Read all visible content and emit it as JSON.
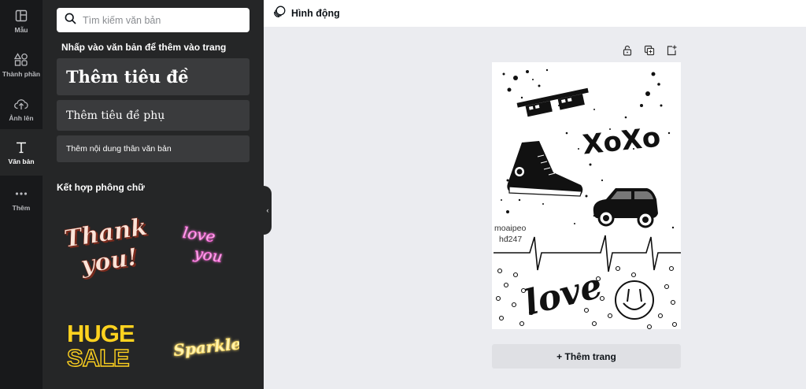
{
  "rail": {
    "items": [
      {
        "label": "Mẫu",
        "icon": "template-icon"
      },
      {
        "label": "Thành phần",
        "icon": "shapes-icon"
      },
      {
        "label": "Ảnh lên",
        "icon": "upload-icon"
      },
      {
        "label": "Văn bản",
        "icon": "text-icon"
      },
      {
        "label": "Thêm",
        "icon": "more-icon"
      }
    ]
  },
  "panel": {
    "search_placeholder": "Tìm kiếm văn bản",
    "heading": "Nhấp vào văn bản để thêm vào trang",
    "add_heading": "Thêm tiêu đề",
    "add_subheading": "Thêm tiêu đề phụ",
    "add_body": "Thêm nội dung thân văn bản",
    "combo_heading": "Kết hợp phông chữ",
    "combos": {
      "thank_line1": "Thank",
      "thank_line2": "you!",
      "love_line1": "love",
      "love_line2": "you",
      "huge_line1": "HUGE",
      "huge_line2": "SALE",
      "sparkle": "Sparkle"
    }
  },
  "topbar": {
    "animate_label": "Hình động"
  },
  "canvas": {
    "caption_line1": "moaipeo",
    "caption_line2": "hđ247",
    "add_page_label": "+ Thêm trang"
  },
  "colors": {
    "rail_bg": "#18191b",
    "panel_bg": "#252627",
    "button_bg": "#3a3b3d",
    "workspace_bg": "#ebecf0",
    "neon_pink": "#ff4fd8",
    "neon_yellow": "#ffd84a",
    "huge_yellow": "#ffd21f"
  }
}
